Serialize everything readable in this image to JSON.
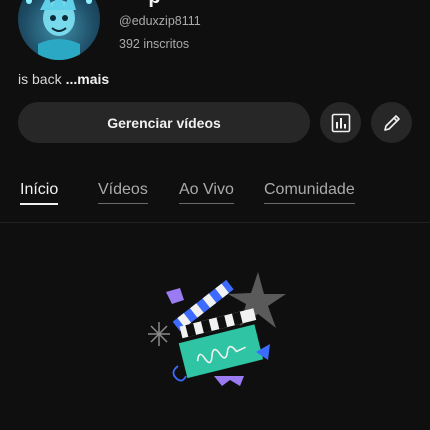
{
  "channel": {
    "name_partial": "· · p",
    "handle": "@eduxzip8111",
    "subscribers": "392 inscritos"
  },
  "description": {
    "text": "is back",
    "more": "...mais"
  },
  "actions": {
    "manage_label": "Gerenciar vídeos",
    "stats_icon": "bar-chart-icon",
    "edit_icon": "pencil-icon"
  },
  "tabs": [
    {
      "label": "Início",
      "active": true
    },
    {
      "label": "Vídeos",
      "active": false
    },
    {
      "label": "Ao Vivo",
      "active": false
    },
    {
      "label": "Comunidade",
      "active": false
    }
  ],
  "empty_state": {
    "illustration": "clapperboard-illustration"
  },
  "colors": {
    "background": "#0f0f0f",
    "button_bg": "#272727",
    "text_primary": "#f1f1f1",
    "text_secondary": "#aaaaaa",
    "accent_teal": "#2ec4a4",
    "accent_purple": "#9b7bf2",
    "accent_blue": "#3d6bff",
    "star_gray": "#5a5a5a"
  }
}
